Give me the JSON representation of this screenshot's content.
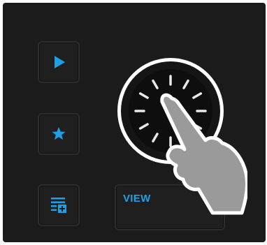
{
  "controls": {
    "view_button": {
      "label": "VIEW"
    }
  },
  "icons": {
    "play": "play-icon",
    "star": "star-icon",
    "list": "add-to-list-icon",
    "hand": "hand-pointer-icon"
  },
  "colors": {
    "accent": "#1ea0e6",
    "panel": "#1b1b1b",
    "ring": "#ffffff",
    "hand": "#9a9a9a"
  }
}
